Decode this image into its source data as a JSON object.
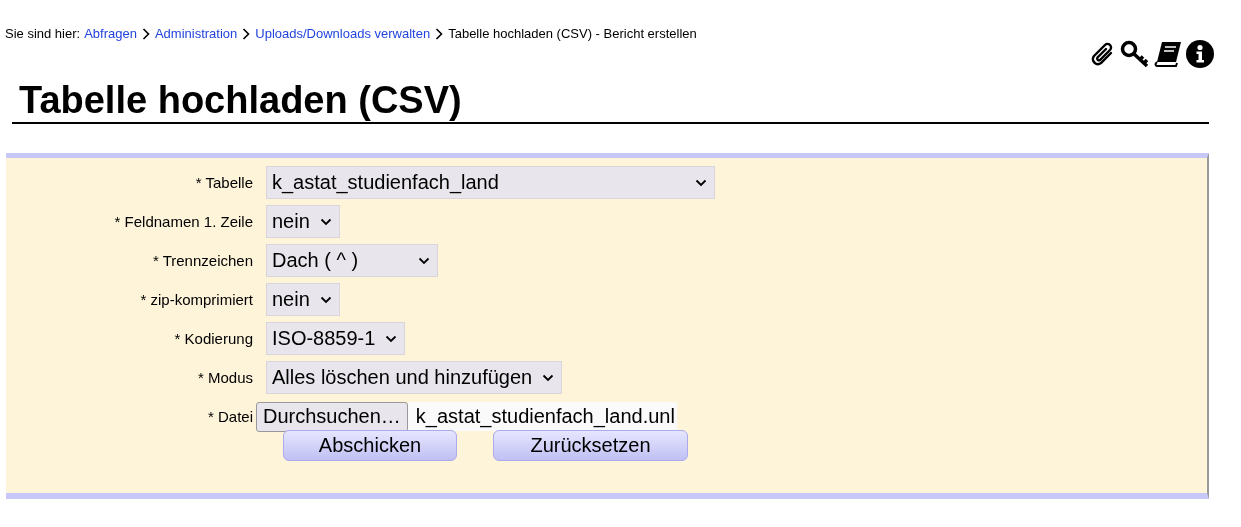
{
  "breadcrumb": {
    "prefix": "Sie sind hier:",
    "links": [
      "Abfragen",
      "Administration",
      "Uploads/Downloads verwalten"
    ],
    "current": "Tabelle hochladen (CSV) - Bericht erstellen"
  },
  "title": "Tabelle hochladen (CSV)",
  "fields": [
    {
      "kind": "select",
      "label": "* Tabelle",
      "value": "k_astat_studienfach_land"
    },
    {
      "kind": "select",
      "label": "* Feldnamen 1. Zeile",
      "value": "nein"
    },
    {
      "kind": "select",
      "label": "* Trennzeichen",
      "value": "Dach ( ^ )"
    },
    {
      "kind": "select",
      "label": "* zip-komprimiert",
      "value": "nein"
    },
    {
      "kind": "select",
      "label": "* Kodierung",
      "value": "ISO-8859-1"
    },
    {
      "kind": "select",
      "label": "* Modus",
      "value": "Alles löschen und hinzufügen"
    },
    {
      "kind": "file",
      "label": "* Datei",
      "button": "Durchsuchen…",
      "value": "k_astat_studienfach_land.unl"
    }
  ],
  "buttons": [
    "Abschicken",
    "Zurücksetzen"
  ]
}
